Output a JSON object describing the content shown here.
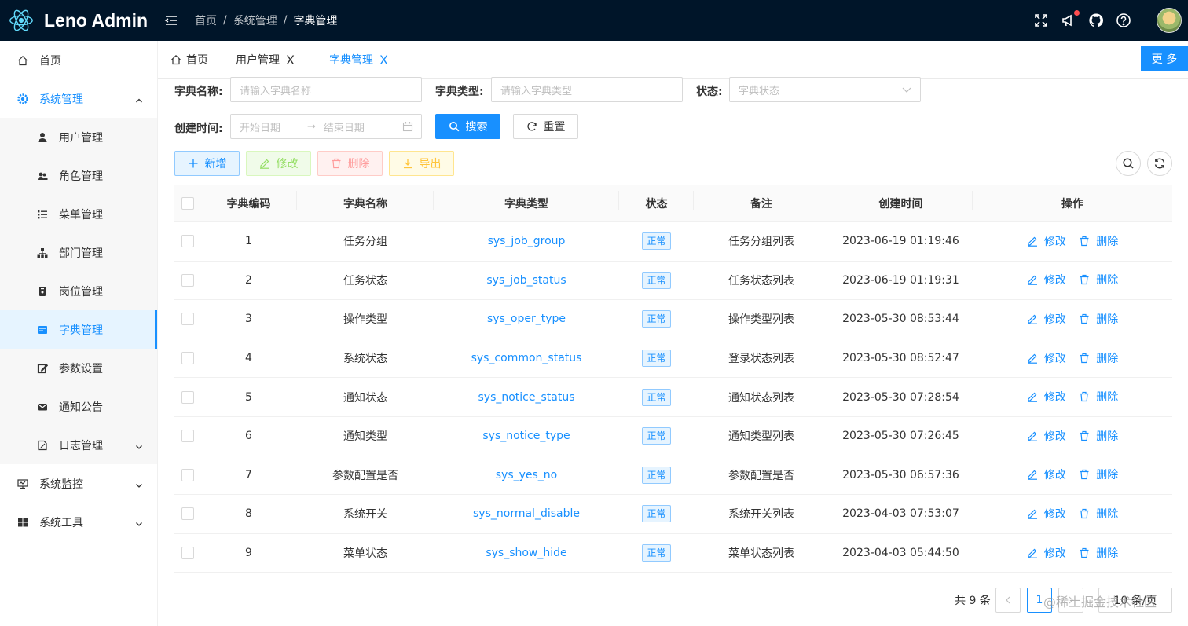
{
  "header": {
    "app_name": "Leno Admin",
    "breadcrumb": [
      "首页",
      "系统管理",
      "字典管理"
    ],
    "breadcrumb_sep": "/"
  },
  "sidebar": {
    "items": [
      {
        "label": "首页",
        "icon": "home-icon"
      },
      {
        "label": "系统管理",
        "icon": "gear-icon",
        "expanded": true
      },
      {
        "label": "用户管理",
        "icon": "user-icon"
      },
      {
        "label": "角色管理",
        "icon": "team-icon"
      },
      {
        "label": "菜单管理",
        "icon": "menu-list-icon"
      },
      {
        "label": "部门管理",
        "icon": "org-tree-icon"
      },
      {
        "label": "岗位管理",
        "icon": "post-icon"
      },
      {
        "label": "字典管理",
        "icon": "dictionary-icon",
        "active": true
      },
      {
        "label": "参数设置",
        "icon": "edit-icon"
      },
      {
        "label": "通知公告",
        "icon": "mail-icon"
      },
      {
        "label": "日志管理",
        "icon": "log-icon"
      },
      {
        "label": "系统监控",
        "icon": "monitor-icon"
      },
      {
        "label": "系统工具",
        "icon": "tools-icon"
      }
    ]
  },
  "tabs": [
    {
      "label": "首页",
      "icon": "home-icon"
    },
    {
      "label": "用户管理",
      "close": "X"
    },
    {
      "label": "字典管理",
      "close": "X",
      "active": true
    }
  ],
  "more_label": "更 多",
  "search": {
    "name_label": "字典名称:",
    "name_placeholder": "请输入字典名称",
    "type_label": "字典类型:",
    "type_placeholder": "请输入字典类型",
    "status_label": "状态:",
    "status_placeholder": "字典状态",
    "time_label": "创建时间:",
    "start_placeholder": "开始日期",
    "end_placeholder": "结束日期",
    "range_arrow": "→",
    "search_btn": "搜索",
    "reset_btn": "重置"
  },
  "toolbar": {
    "add": "新增",
    "edit": "修改",
    "delete": "删除",
    "export": "导出"
  },
  "table": {
    "columns": [
      "字典编码",
      "字典名称",
      "字典类型",
      "状态",
      "备注",
      "创建时间",
      "操作"
    ],
    "rows": [
      {
        "id": "1",
        "name": "任务分组",
        "type": "sys_job_group",
        "status": "正常",
        "remark": "任务分组列表",
        "time": "2023-06-19 01:19:46"
      },
      {
        "id": "2",
        "name": "任务状态",
        "type": "sys_job_status",
        "status": "正常",
        "remark": "任务状态列表",
        "time": "2023-06-19 01:19:31"
      },
      {
        "id": "3",
        "name": "操作类型",
        "type": "sys_oper_type",
        "status": "正常",
        "remark": "操作类型列表",
        "time": "2023-05-30 08:53:44"
      },
      {
        "id": "4",
        "name": "系统状态",
        "type": "sys_common_status",
        "status": "正常",
        "remark": "登录状态列表",
        "time": "2023-05-30 08:52:47"
      },
      {
        "id": "5",
        "name": "通知状态",
        "type": "sys_notice_status",
        "status": "正常",
        "remark": "通知状态列表",
        "time": "2023-05-30 07:28:54"
      },
      {
        "id": "6",
        "name": "通知类型",
        "type": "sys_notice_type",
        "status": "正常",
        "remark": "通知类型列表",
        "time": "2023-05-30 07:26:45"
      },
      {
        "id": "7",
        "name": "参数配置是否",
        "type": "sys_yes_no",
        "status": "正常",
        "remark": "参数配置是否",
        "time": "2023-05-30 06:57:36"
      },
      {
        "id": "8",
        "name": "系统开关",
        "type": "sys_normal_disable",
        "status": "正常",
        "remark": "系统开关列表",
        "time": "2023-04-03 07:53:07"
      },
      {
        "id": "9",
        "name": "菜单状态",
        "type": "sys_show_hide",
        "status": "正常",
        "remark": "菜单状态列表",
        "time": "2023-04-03 05:44:50"
      }
    ],
    "op_edit": "修改",
    "op_delete": "删除"
  },
  "pagination": {
    "total": "共 9 条",
    "current": "1",
    "page_size": "10 条/页"
  },
  "watermark": "@稀土掘金技术社区",
  "colors": {
    "header_bg": "#001529",
    "primary": "#1890ff"
  }
}
